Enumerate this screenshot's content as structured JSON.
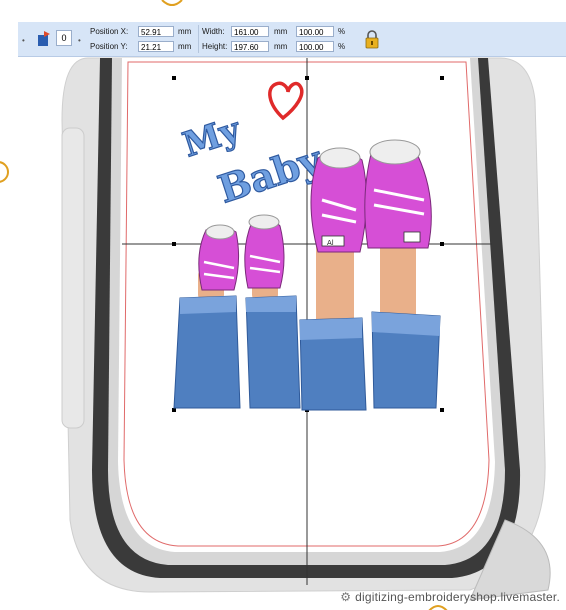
{
  "toolbar": {
    "rotation_value": "0",
    "position_x_label": "Position X:",
    "position_x_value": "52.91",
    "position_y_label": "Position Y:",
    "position_y_value": "21.21",
    "position_unit": "mm",
    "width_label": "Width:",
    "width_value": "161.00",
    "height_label": "Height:",
    "height_value": "197.60",
    "size_unit": "mm",
    "width_percent": "100.00",
    "height_percent": "100.00",
    "percent_unit": "%"
  },
  "design": {
    "title_line1": "My",
    "title_line2": "Baby",
    "shoe_tag": "Al"
  },
  "watermark": {
    "text": "digitizing-embroideryshop.livemaster."
  },
  "colors": {
    "toolbar_bg": "#d7e5f7",
    "hoop_dark": "#3c3c3c",
    "hoop_light": "#d9d9d9",
    "sewing_field": "#e06a6a",
    "title_blue": "#5b8fd6",
    "heart_red": "#e02a2a",
    "sneaker_pink": "#d64fd6",
    "denim_blue": "#4f7fc0",
    "accent_orange": "#e0a020"
  }
}
